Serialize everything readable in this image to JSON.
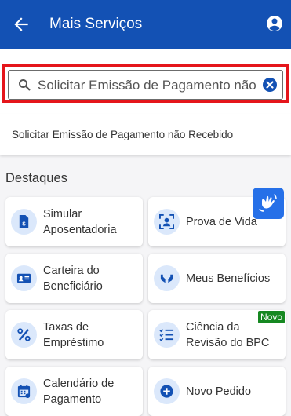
{
  "header": {
    "title": "Mais Serviços",
    "background": "#1351b4"
  },
  "search": {
    "value": "Solicitar Emissão de Pagamento não",
    "highlight_color": "#e5151b"
  },
  "suggestion": {
    "text": "Solicitar Emissão de Pagamento não Recebido"
  },
  "section": {
    "title": "Destaques"
  },
  "cards": [
    {
      "label": "Simular\nAposentadoria",
      "icon": "calculator-document-icon"
    },
    {
      "label": "Prova de Vida",
      "icon": "person-frame-icon"
    },
    {
      "label": "Carteira do\nBeneficiário",
      "icon": "id-card-icon"
    },
    {
      "label": "Meus Benefícios",
      "icon": "hands-icon"
    },
    {
      "label": "Taxas de\nEmpréstimo",
      "icon": "percent-icon"
    },
    {
      "label": "Ciência da\nRevisão do BPC",
      "icon": "checklist-icon"
    },
    {
      "label": "Calendário de\nPagamento",
      "icon": "calendar-icon"
    },
    {
      "label": "Novo Pedido",
      "icon": "plus-circle-icon"
    }
  ],
  "badge": {
    "text": "Novo",
    "color": "#168821"
  },
  "accessibility": {
    "icon": "sign-language-icon",
    "color": "#2670e8"
  }
}
